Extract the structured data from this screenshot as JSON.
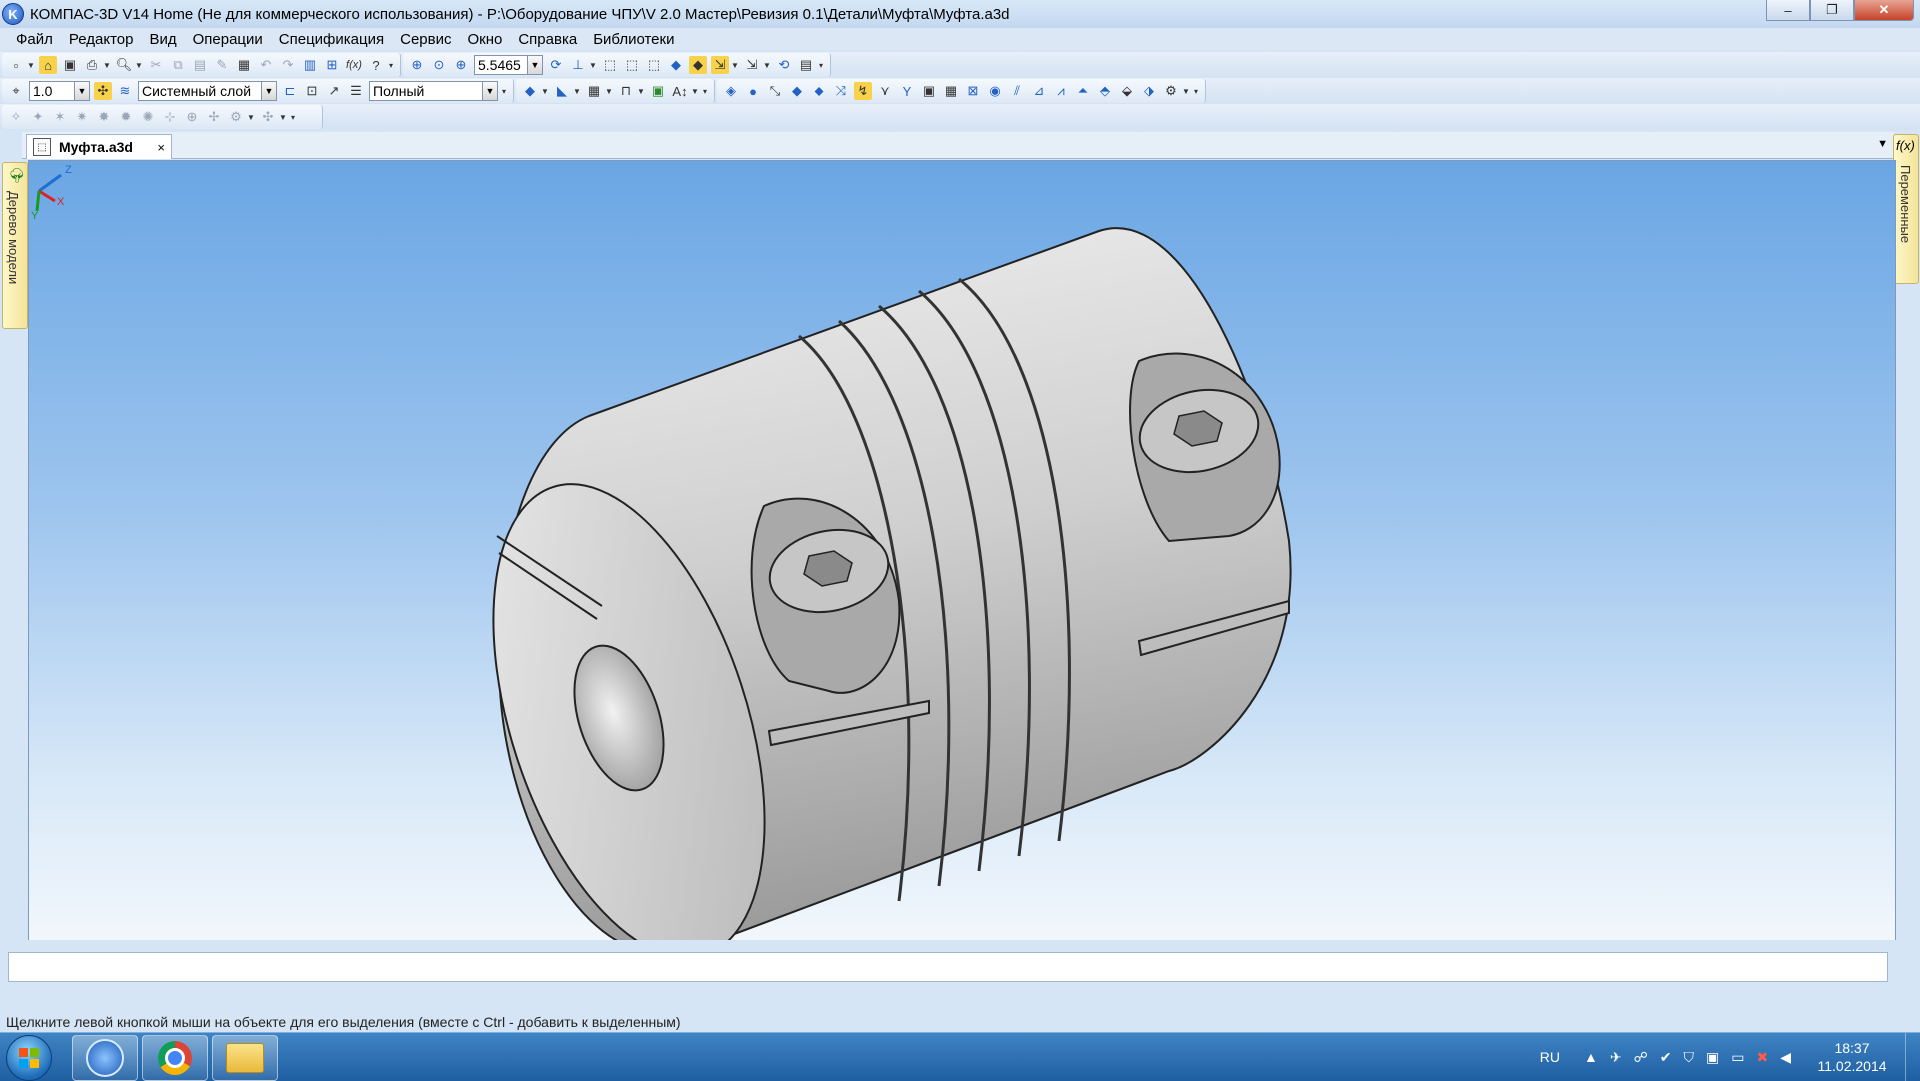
{
  "window": {
    "title": "КОМПАС-3D V14 Home (Не для коммерческого использования) - P:\\Оборудование ЧПУ\\V 2.0 Мастер\\Ревизия 0.1\\Детали\\Муфта\\Муфта.a3d",
    "app_icon_letter": "K",
    "minimize": "–",
    "maximize": "❐",
    "close": "✕"
  },
  "menu": [
    "Файл",
    "Редактор",
    "Вид",
    "Операции",
    "Спецификация",
    "Сервис",
    "Окно",
    "Справка",
    "Библиотеки"
  ],
  "toolbar1": {
    "zoom_value": "5.5465"
  },
  "toolbar2": {
    "step_value": "1.0",
    "layer_value": "Системный слой",
    "mode_value": "Полный"
  },
  "document_tab": {
    "label": "Муфта.a3d",
    "close": "×"
  },
  "left_panel": {
    "label": "Дерево модели"
  },
  "right_panel": {
    "fx": "f(x)",
    "label": "Переменные"
  },
  "axis": {
    "z": "Z",
    "x": "X",
    "y": "Y"
  },
  "status": {
    "hint": "Щелкните левой кнопкой мыши на объекте для его выделения (вместе с Ctrl - добавить к выделенным)"
  },
  "taskbar": {
    "language": "RU",
    "time": "18:37",
    "date": "11.02.2014"
  },
  "colors": {
    "viewport_top": "#6aa6e4",
    "viewport_bottom": "#f2f7fc",
    "part_light": "#d8d8d8",
    "part_dark": "#8c8c8c",
    "taskbar": "#1f5fa1"
  }
}
